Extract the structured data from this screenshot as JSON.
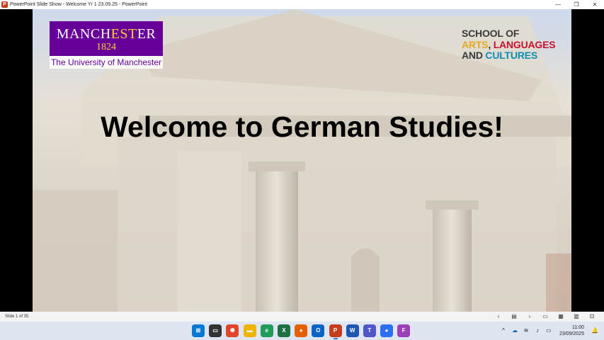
{
  "window": {
    "title": "PowerPoint Slide Show  -  Welcome Yr 1 23.09.25  -  PowerPoint",
    "app_icon": "powerpoint-icon",
    "controls": [
      "minimize-icon",
      "restore-icon",
      "close-icon"
    ]
  },
  "slide": {
    "title": "Welcome to German Studies!",
    "logo_left": {
      "line1_a": "MANCH",
      "line1_b": "EST",
      "line1_c": "ER",
      "line2": "1824",
      "subtitle": "The University of Manchester"
    },
    "logo_right": {
      "line1": "SCHOOL OF",
      "line2_a": "ARTS",
      "line2_b": ", ",
      "line2_c": "LANGUAGES",
      "line3_a": "AND ",
      "line3_b": "CULTURES"
    }
  },
  "statusbar": {
    "slide_counter": "Slide 1 of 35",
    "controls": [
      "previous-icon",
      "slide-menu-icon",
      "next-icon",
      "normal-view-icon",
      "slide-sorter-icon",
      "reading-view-icon",
      "slideshow-icon"
    ]
  },
  "taskbar": {
    "apps": [
      {
        "name": "start",
        "color": "#0078d4",
        "glyph": "⊞"
      },
      {
        "name": "task-view",
        "color": "#333333",
        "glyph": "▭"
      },
      {
        "name": "settings",
        "color": "#e0452b",
        "glyph": "✺"
      },
      {
        "name": "file-explorer",
        "color": "#f0b400",
        "glyph": "▬"
      },
      {
        "name": "edge",
        "color": "#1f9b5a",
        "glyph": "e"
      },
      {
        "name": "excel",
        "color": "#1d7044",
        "glyph": "X"
      },
      {
        "name": "firefox",
        "color": "#e66000",
        "glyph": "●"
      },
      {
        "name": "outlook",
        "color": "#0a64c4",
        "glyph": "O"
      },
      {
        "name": "powerpoint",
        "color": "#c43e1c",
        "glyph": "P"
      },
      {
        "name": "word",
        "color": "#1f56b3",
        "glyph": "W"
      },
      {
        "name": "teams",
        "color": "#5058c8",
        "glyph": "T"
      },
      {
        "name": "zoom",
        "color": "#2d6ff2",
        "glyph": "●"
      },
      {
        "name": "app-purple",
        "color": "#9b3fb8",
        "glyph": "F"
      }
    ],
    "tray": {
      "time": "11:00",
      "date": "23/09/2025"
    }
  }
}
